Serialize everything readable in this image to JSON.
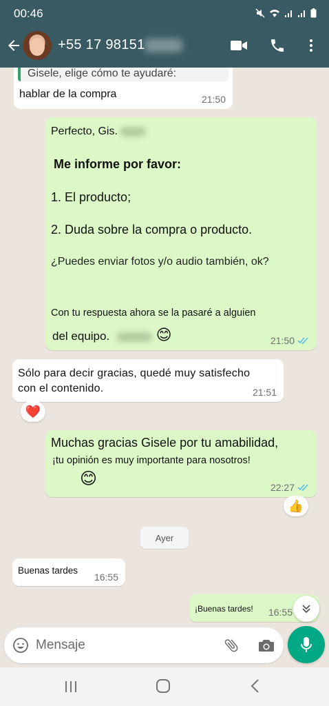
{
  "status_bar": {
    "time": "00:46"
  },
  "header": {
    "contact_name": "+55 17 98151"
  },
  "messages": {
    "quoted_text": "Gisele, elige cómo te ayudaré:",
    "quoted_reply": "hablar de la compra",
    "quoted_reply_time": "21:50",
    "m1_line1": "Perfecto, Gis.",
    "m1_line2": "Me informe por favor:",
    "m1_line3": "1. El producto;",
    "m1_line4": "2. Duda sobre la compra o producto.",
    "m1_line5": "¿Puedes enviar fotos y/o audio también, ok?",
    "m1_line6": "Con tu respuesta ahora se la pasaré a alguien",
    "m1_line7": "del equipo.",
    "m1_emoji": "😊",
    "m1_time": "21:50",
    "m2_line1": "Sólo para decir gracias, quedé muy satisfecho",
    "m2_line2": "con el contenido.",
    "m2_time": "21:51",
    "m2_reaction": "❤️",
    "m3_line1": "Muchas gracias Gisele por tu amabilidad,",
    "m3_line2": "¡tu opinión es muy importante para nosotros!",
    "m3_emoji": "😊",
    "m3_time": "22:27",
    "m3_reaction": "👍",
    "date_separator": "Ayer",
    "m4_text": "Buenas tardes",
    "m4_time": "16:55",
    "m5_text": "¡Buenas tardes!",
    "m5_time": "16:55"
  },
  "input": {
    "placeholder": "Mensaje"
  },
  "colors": {
    "header_bg": "#3a5a63",
    "outgoing_bubble": "#dcf8c6",
    "incoming_bubble": "#ffffff",
    "chat_bg": "#ece5dd",
    "mic_button": "#00a884",
    "read_ticks": "#53bdeb"
  }
}
